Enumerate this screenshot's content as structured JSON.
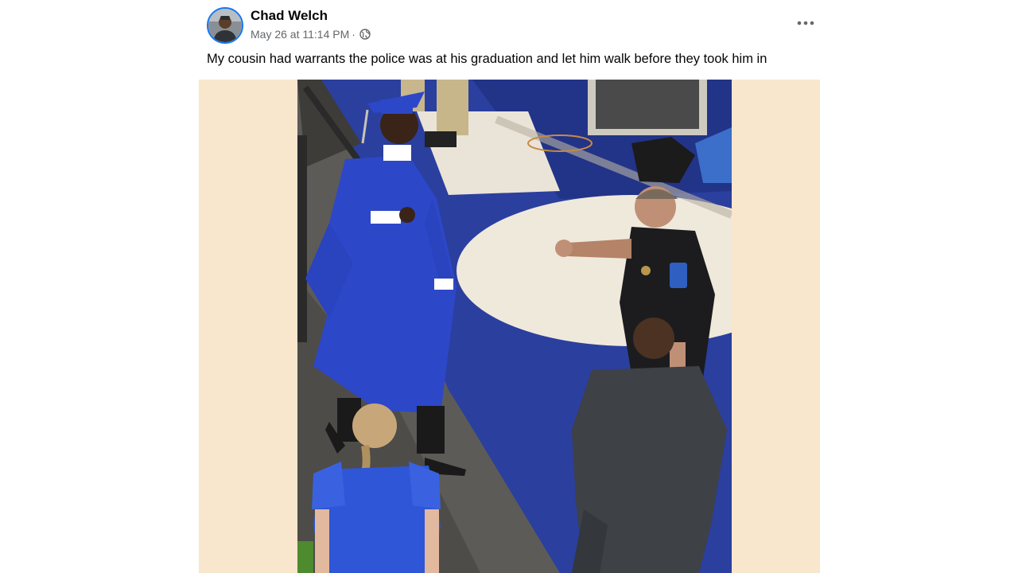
{
  "post": {
    "author": "Chad Welch",
    "timestamp": "May 26 at 11:14 PM",
    "separator": "·",
    "audience_icon": "globe-icon",
    "more_icon": "more-options-icon",
    "caption": "My cousin had warrants the police was at his graduation and let him walk before they took him in",
    "photo": {
      "description_icon": "graduation-photo"
    }
  },
  "colors": {
    "author_text": "#050505",
    "meta_text": "#65676b",
    "avatar_ring": "#1877f2",
    "media_background": "#f8e6cd",
    "gown_blue": "#2d47c9"
  }
}
